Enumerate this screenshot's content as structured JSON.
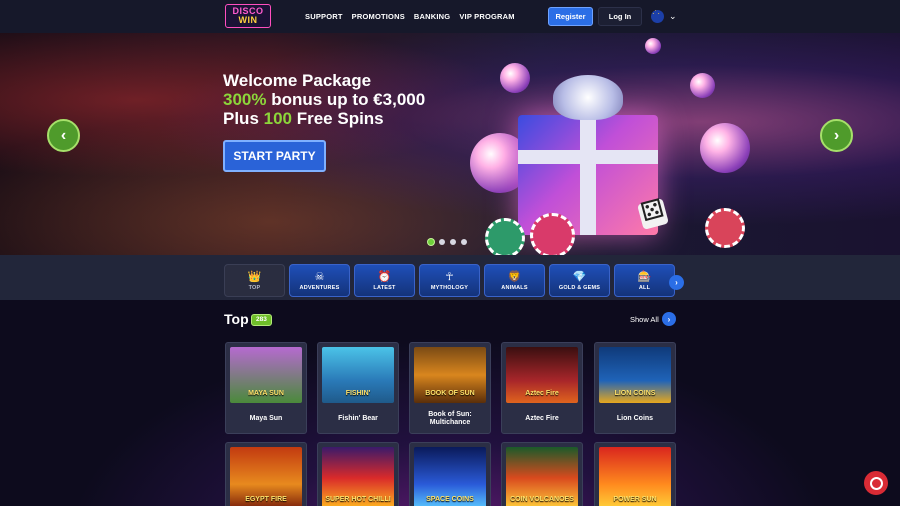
{
  "brand": {
    "logo_line1": "DISCO",
    "logo_line2": "WIN"
  },
  "nav": {
    "items": [
      "SUPPORT",
      "PROMOTIONS",
      "BANKING",
      "VIP PROGRAM"
    ]
  },
  "auth": {
    "register": "Register",
    "login": "Log In"
  },
  "hero": {
    "line1": "Welcome Package",
    "line2_highlight": "300%",
    "line2_rest": " bonus up to €3,000",
    "line3_pre": "Plus ",
    "line3_highlight": "100",
    "line3_rest": " Free Spins",
    "cta": "START PARTY",
    "slides": 4,
    "active_slide": 1
  },
  "categories": [
    {
      "label": "TOP",
      "icon": "crown-icon",
      "glyph": "👑",
      "active": true
    },
    {
      "label": "ADVENTURES",
      "icon": "pirate-icon",
      "glyph": "☠",
      "active": false
    },
    {
      "label": "LATEST",
      "icon": "clock-icon",
      "glyph": "⏰",
      "active": false
    },
    {
      "label": "MYTHOLOGY",
      "icon": "pharaoh-icon",
      "glyph": "𓂀",
      "active": false
    },
    {
      "label": "ANIMALS",
      "icon": "animal-icon",
      "glyph": "🦁",
      "active": false
    },
    {
      "label": "GOLD & GEMS",
      "icon": "gems-icon",
      "glyph": "💎",
      "active": false
    },
    {
      "label": "ALL",
      "icon": "slot-machine-icon",
      "glyph": "🎰",
      "active": false
    }
  ],
  "section": {
    "title": "Top",
    "count": "283",
    "show_all": "Show All"
  },
  "games": [
    {
      "name": "Maya Sun",
      "art": "MAYA SUN"
    },
    {
      "name": "Fishin' Bear",
      "art": "FISHIN'"
    },
    {
      "name": "Book of Sun: Multichance",
      "art": "BOOK OF SUN"
    },
    {
      "name": "Aztec Fire",
      "art": "Aztec Fire"
    },
    {
      "name": "Lion Coins",
      "art": "LION COINS"
    }
  ],
  "games_row2": [
    {
      "art": "EGYPT FIRE"
    },
    {
      "art": "SUPER HOT CHILLI"
    },
    {
      "art": "SPACE COINS"
    },
    {
      "art": "COIN VOLCANOES"
    },
    {
      "art": "POWER SUN"
    }
  ],
  "colors": {
    "accent_blue": "#2b6ee6",
    "accent_green": "#8cd63a",
    "header_bg": "#16182a",
    "catbar_bg": "#22263a"
  }
}
